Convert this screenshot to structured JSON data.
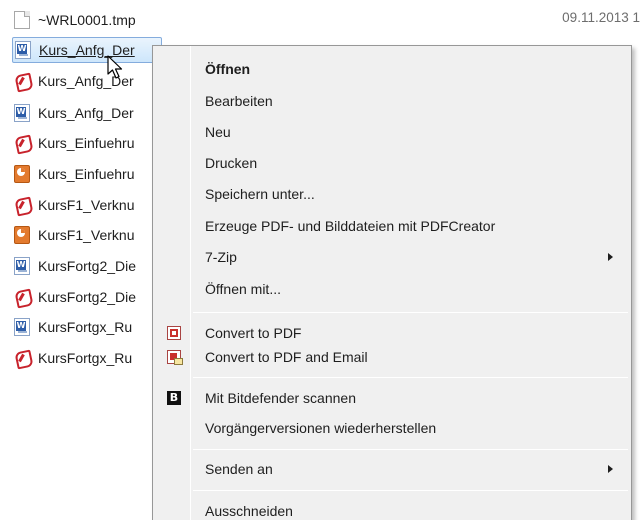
{
  "files": [
    {
      "name": "~WRL0001.tmp",
      "type": "tmp",
      "date": "09.11.2013 1"
    },
    {
      "name": "Kurs_Anfg_Der",
      "type": "word",
      "selected": true
    },
    {
      "name": "Kurs_Anfg_Der",
      "type": "pdf"
    },
    {
      "name": "Kurs_Anfg_Der",
      "type": "word"
    },
    {
      "name": "Kurs_Einfuehru",
      "type": "pdf"
    },
    {
      "name": "Kurs_Einfuehru",
      "type": "ppt"
    },
    {
      "name": "KursF1_Verknu",
      "type": "pdf"
    },
    {
      "name": "KursF1_Verknu",
      "type": "ppt"
    },
    {
      "name": "KursFortg2_Die",
      "type": "word"
    },
    {
      "name": "KursFortg2_Die",
      "type": "pdf"
    },
    {
      "name": "KursFortgx_Ru",
      "type": "word"
    },
    {
      "name": "KursFortgx_Ru",
      "type": "pdf"
    }
  ],
  "context_menu": {
    "items": [
      {
        "label": "Öffnen",
        "bold": true
      },
      {
        "label": "Bearbeiten"
      },
      {
        "label": "Neu"
      },
      {
        "label": "Drucken"
      },
      {
        "label": "Speichern unter..."
      },
      {
        "label": "Erzeuge PDF- und Bilddateien mit PDFCreator"
      },
      {
        "label": "7-Zip",
        "submenu": true
      },
      {
        "label": "Öffnen mit..."
      },
      {
        "label": "Convert to PDF",
        "icon": "convert-to-pdf-icon"
      },
      {
        "label": "Convert to PDF and Email",
        "icon": "convert-to-pdf-email-icon"
      },
      {
        "label": "Mit Bitdefender scannen",
        "icon": "bitdefender-icon",
        "icon_text": "B"
      },
      {
        "label": "Vorgängerversionen wiederherstellen"
      },
      {
        "label": "Senden an",
        "submenu": true
      },
      {
        "label": "Ausschneiden"
      }
    ]
  },
  "colors": {
    "menu_background": "#f0f0f0",
    "selection_background": "#cde6fb",
    "selection_border": "#84acdd",
    "pdf_red": "#c8232c",
    "word_blue": "#2d5da8"
  }
}
